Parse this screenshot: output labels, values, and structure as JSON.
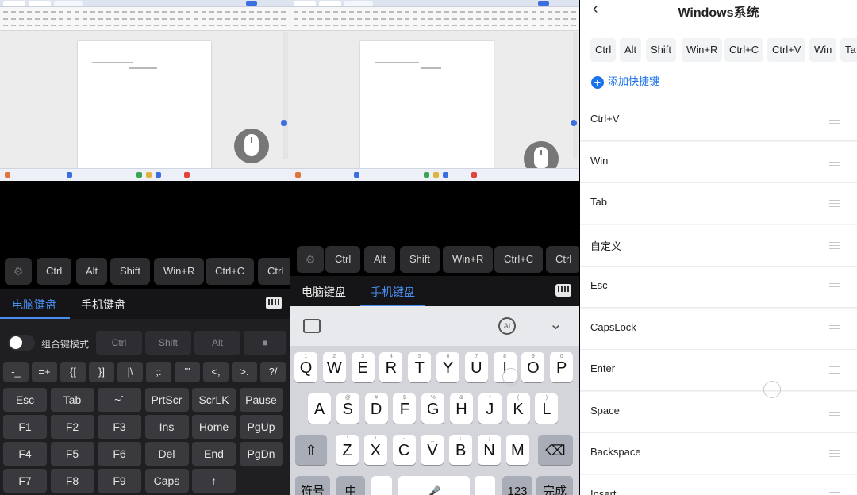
{
  "left_phone": {
    "shortcut_strip": [
      "Ctrl",
      "Alt",
      "Shift",
      "Win+R",
      "Ctrl+C",
      "Ctrl"
    ],
    "tabs": [
      {
        "label": "电脑键盘",
        "active": true
      },
      {
        "label": "手机键盘",
        "active": false
      }
    ],
    "combo_mode_label": "组合键模式",
    "modifier_keys": [
      "Ctrl",
      "Shift",
      "Alt"
    ],
    "symbol_row": [
      "-_",
      "=+",
      "{[",
      "}]",
      "|\\",
      ";:",
      "'\"",
      "<,",
      ">.",
      "?/"
    ],
    "key_rows": [
      [
        "Esc",
        "Tab",
        "~`",
        "PrtScr",
        "ScrLK",
        "Pause"
      ],
      [
        "F1",
        "F2",
        "F3",
        "Ins",
        "Home",
        "PgUp"
      ],
      [
        "F4",
        "F5",
        "F6",
        "Del",
        "End",
        "PgDn"
      ],
      [
        "F7",
        "F8",
        "F9",
        "Caps",
        "↑"
      ]
    ]
  },
  "middle_phone": {
    "shortcut_strip": [
      "Ctrl",
      "Alt",
      "Shift",
      "Win+R",
      "Ctrl+C",
      "Ctrl"
    ],
    "tabs": [
      {
        "label": "电脑键盘",
        "active": false
      },
      {
        "label": "手机键盘",
        "active": true
      }
    ],
    "rows": [
      {
        "keys": [
          "Q",
          "W",
          "E",
          "R",
          "T",
          "Y",
          "U",
          "I",
          "O",
          "P"
        ],
        "hints": [
          "1",
          "2",
          "3",
          "4",
          "5",
          "6",
          "7",
          "8",
          "9",
          "0"
        ]
      },
      {
        "keys": [
          "A",
          "S",
          "D",
          "F",
          "G",
          "H",
          "J",
          "K",
          "L"
        ],
        "hints": [
          "~",
          "@",
          "#",
          "$",
          "%",
          "&",
          "*",
          "(",
          ")"
        ]
      },
      {
        "keys": [
          "Z",
          "X",
          "C",
          "V",
          "B",
          "N",
          "M"
        ],
        "hints": [
          "'",
          "/",
          "-",
          "_",
          ":",
          ";",
          ""
        ]
      }
    ],
    "bottom_row": [
      "符号",
      "中",
      "",
      "",
      "",
      "123",
      "完成"
    ]
  },
  "settings": {
    "title": "Windows系统",
    "quick_chips": [
      "Ctrl",
      "Alt",
      "Shift",
      "Win+R",
      "Ctrl+C",
      "Ctrl+V",
      "Win",
      "Ta"
    ],
    "add_label": "添加快捷键",
    "items": [
      "Ctrl+V",
      "Win",
      "Tab",
      "自定义",
      "Esc",
      "CapsLock",
      "Enter",
      "Space",
      "Backspace",
      "Insert"
    ]
  }
}
